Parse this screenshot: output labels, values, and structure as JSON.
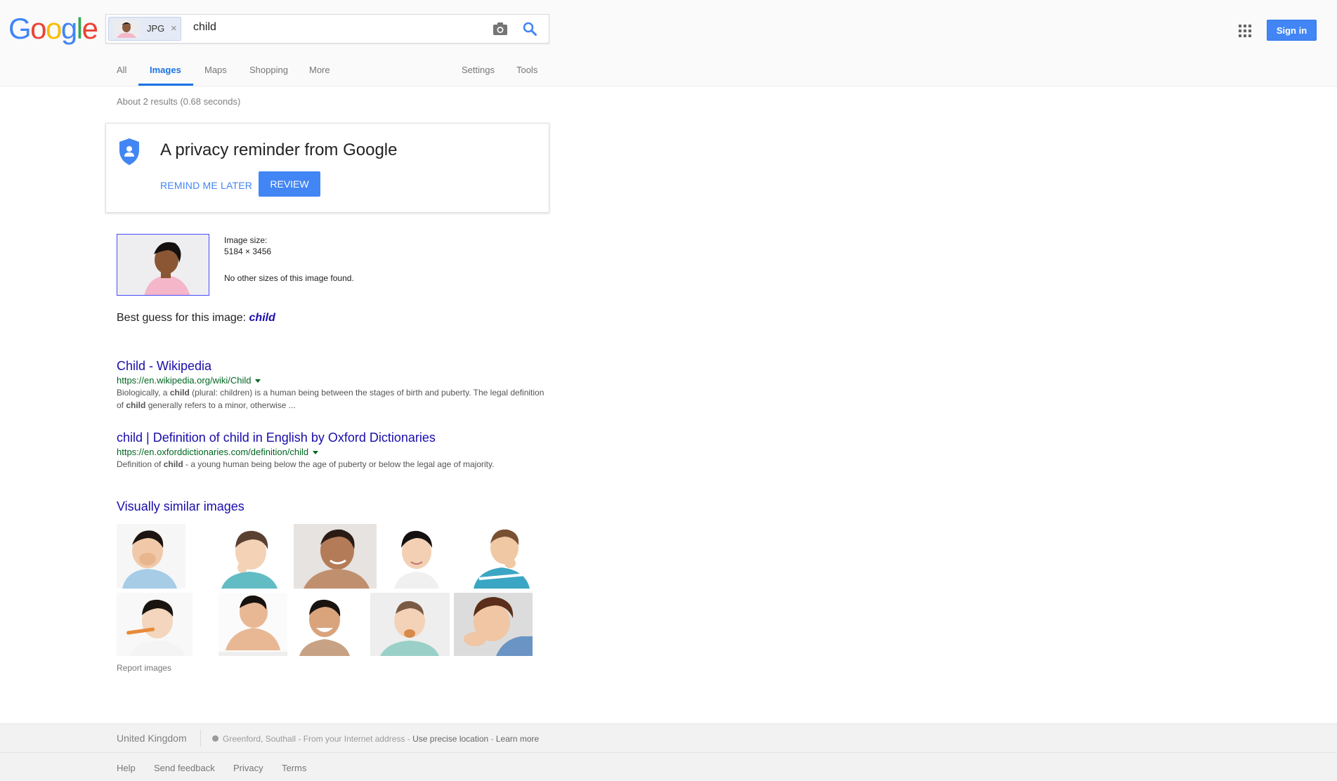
{
  "header": {
    "search": {
      "chip_label": "JPG",
      "chip_close": "×",
      "query": "child"
    },
    "signin_label": "Sign in",
    "tabs": [
      {
        "label": "All"
      },
      {
        "label": "Images"
      },
      {
        "label": "Maps"
      },
      {
        "label": "Shopping"
      },
      {
        "label": "More"
      },
      {
        "label": "Settings"
      },
      {
        "label": "Tools"
      }
    ],
    "active_tab": "Images",
    "accent_color": "#4285f4"
  },
  "results": {
    "stats": "About 2 results (0.68 seconds)",
    "privacy": {
      "title": "A privacy reminder from Google",
      "remind_label": "REMIND ME LATER",
      "review_label": "REVIEW"
    },
    "image_info": {
      "size_label": "Image size:",
      "size_value": "5184 × 3456",
      "no_sizes": "No other sizes of this image found."
    },
    "best_guess": {
      "prefix": "Best guess for this image: ",
      "term": "child"
    },
    "items": [
      {
        "title": "Child - Wikipedia",
        "url": "https://en.wikipedia.org/wiki/Child",
        "snippet_parts": [
          "Biologically, a ",
          "child",
          " (plural: children) is a human being between the stages of birth and puberty. The legal definition of ",
          "child",
          " generally refers to a minor, otherwise ..."
        ]
      },
      {
        "title": "child | Definition of child in English by Oxford Dictionaries",
        "url": "https://en.oxforddictionaries.com/definition/child",
        "snippet_parts": [
          "Definition of ",
          "child",
          " - a young human being below the age of puberty or below the legal age of majority."
        ]
      }
    ],
    "similar_title": "Visually similar images",
    "report_label": "Report images"
  },
  "footer": {
    "country": "United Kingdom",
    "location": "Greenford, Southall",
    "location_suffix": " - From your Internet address - ",
    "precise_label": "Use precise location",
    "separator": " - ",
    "learn_label": "Learn more",
    "links": [
      "Help",
      "Send feedback",
      "Privacy",
      "Terms"
    ]
  }
}
